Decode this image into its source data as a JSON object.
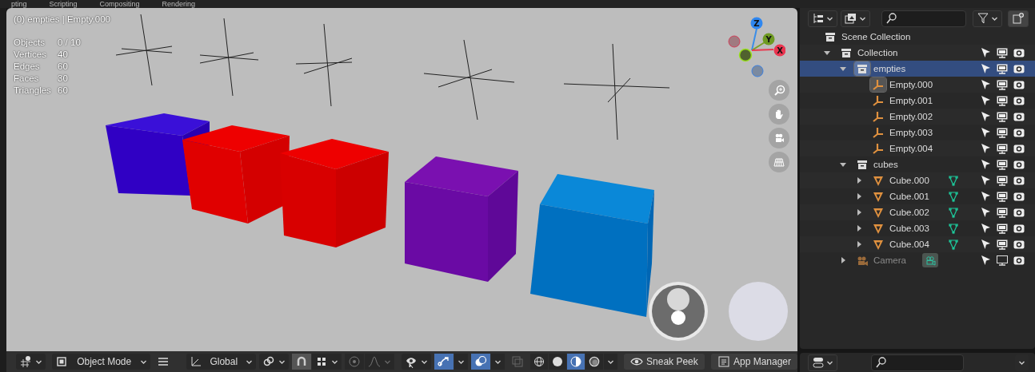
{
  "top_tabs": [
    {
      "label": "pting"
    },
    {
      "label": "Scripting"
    },
    {
      "label": "Compositing"
    },
    {
      "label": "Rendering"
    }
  ],
  "viewport": {
    "info": "(0) empties | Empty.000",
    "stats": [
      {
        "label": "Objects",
        "value": "0 / 10"
      },
      {
        "label": "Vertices",
        "value": "40"
      },
      {
        "label": "Edges",
        "value": "60"
      },
      {
        "label": "Faces",
        "value": "30"
      },
      {
        "label": "Triangles",
        "value": "60"
      }
    ],
    "gizmo": {
      "z": "Z",
      "y": "Y",
      "x": "X"
    },
    "header": {
      "mode": "Object Mode",
      "orientation": "Global",
      "gizmos_on": true,
      "overlays_on": true,
      "shading": [
        {
          "selected": false
        },
        {
          "selected": false
        },
        {
          "selected": true
        },
        {
          "selected": false
        }
      ],
      "buttons": [
        {
          "label": "Sneak Peek"
        },
        {
          "label": "App Manager"
        }
      ]
    }
  },
  "outliner": {
    "tree": [
      {
        "label": "Scene Collection",
        "kind": "scene",
        "children": [
          {
            "label": "Collection",
            "kind": "collection",
            "expanded": true,
            "selected": false,
            "active": false,
            "visible": true,
            "children": [
              {
                "label": "empties",
                "kind": "collection",
                "expanded": true,
                "selected": true,
                "active": true,
                "visible": true,
                "children": [
                  {
                    "label": "Empty.000",
                    "kind": "empty",
                    "selected": false,
                    "active": true,
                    "visible": true
                  },
                  {
                    "label": "Empty.001",
                    "kind": "empty",
                    "selected": false,
                    "active": false,
                    "visible": true
                  },
                  {
                    "label": "Empty.002",
                    "kind": "empty",
                    "selected": false,
                    "active": false,
                    "visible": true
                  },
                  {
                    "label": "Empty.003",
                    "kind": "empty",
                    "selected": false,
                    "active": false,
                    "visible": true
                  },
                  {
                    "label": "Empty.004",
                    "kind": "empty",
                    "selected": false,
                    "active": false,
                    "visible": true
                  }
                ]
              },
              {
                "label": "cubes",
                "kind": "collection",
                "expanded": true,
                "selected": false,
                "active": false,
                "visible": true,
                "children": [
                  {
                    "label": "Cube.000",
                    "kind": "mesh",
                    "expanded": false,
                    "selected": false,
                    "active": false,
                    "visible": true
                  },
                  {
                    "label": "Cube.001",
                    "kind": "mesh",
                    "expanded": false,
                    "selected": false,
                    "active": false,
                    "visible": true
                  },
                  {
                    "label": "Cube.002",
                    "kind": "mesh",
                    "expanded": false,
                    "selected": false,
                    "active": false,
                    "visible": true
                  },
                  {
                    "label": "Cube.003",
                    "kind": "mesh",
                    "expanded": false,
                    "selected": false,
                    "active": false,
                    "visible": true
                  },
                  {
                    "label": "Cube.004",
                    "kind": "mesh",
                    "expanded": false,
                    "selected": false,
                    "active": false,
                    "visible": true
                  }
                ]
              },
              {
                "label": "Camera",
                "kind": "camera",
                "expanded": false,
                "selected": false,
                "active": false,
                "visible": false
              }
            ]
          }
        ]
      }
    ]
  }
}
